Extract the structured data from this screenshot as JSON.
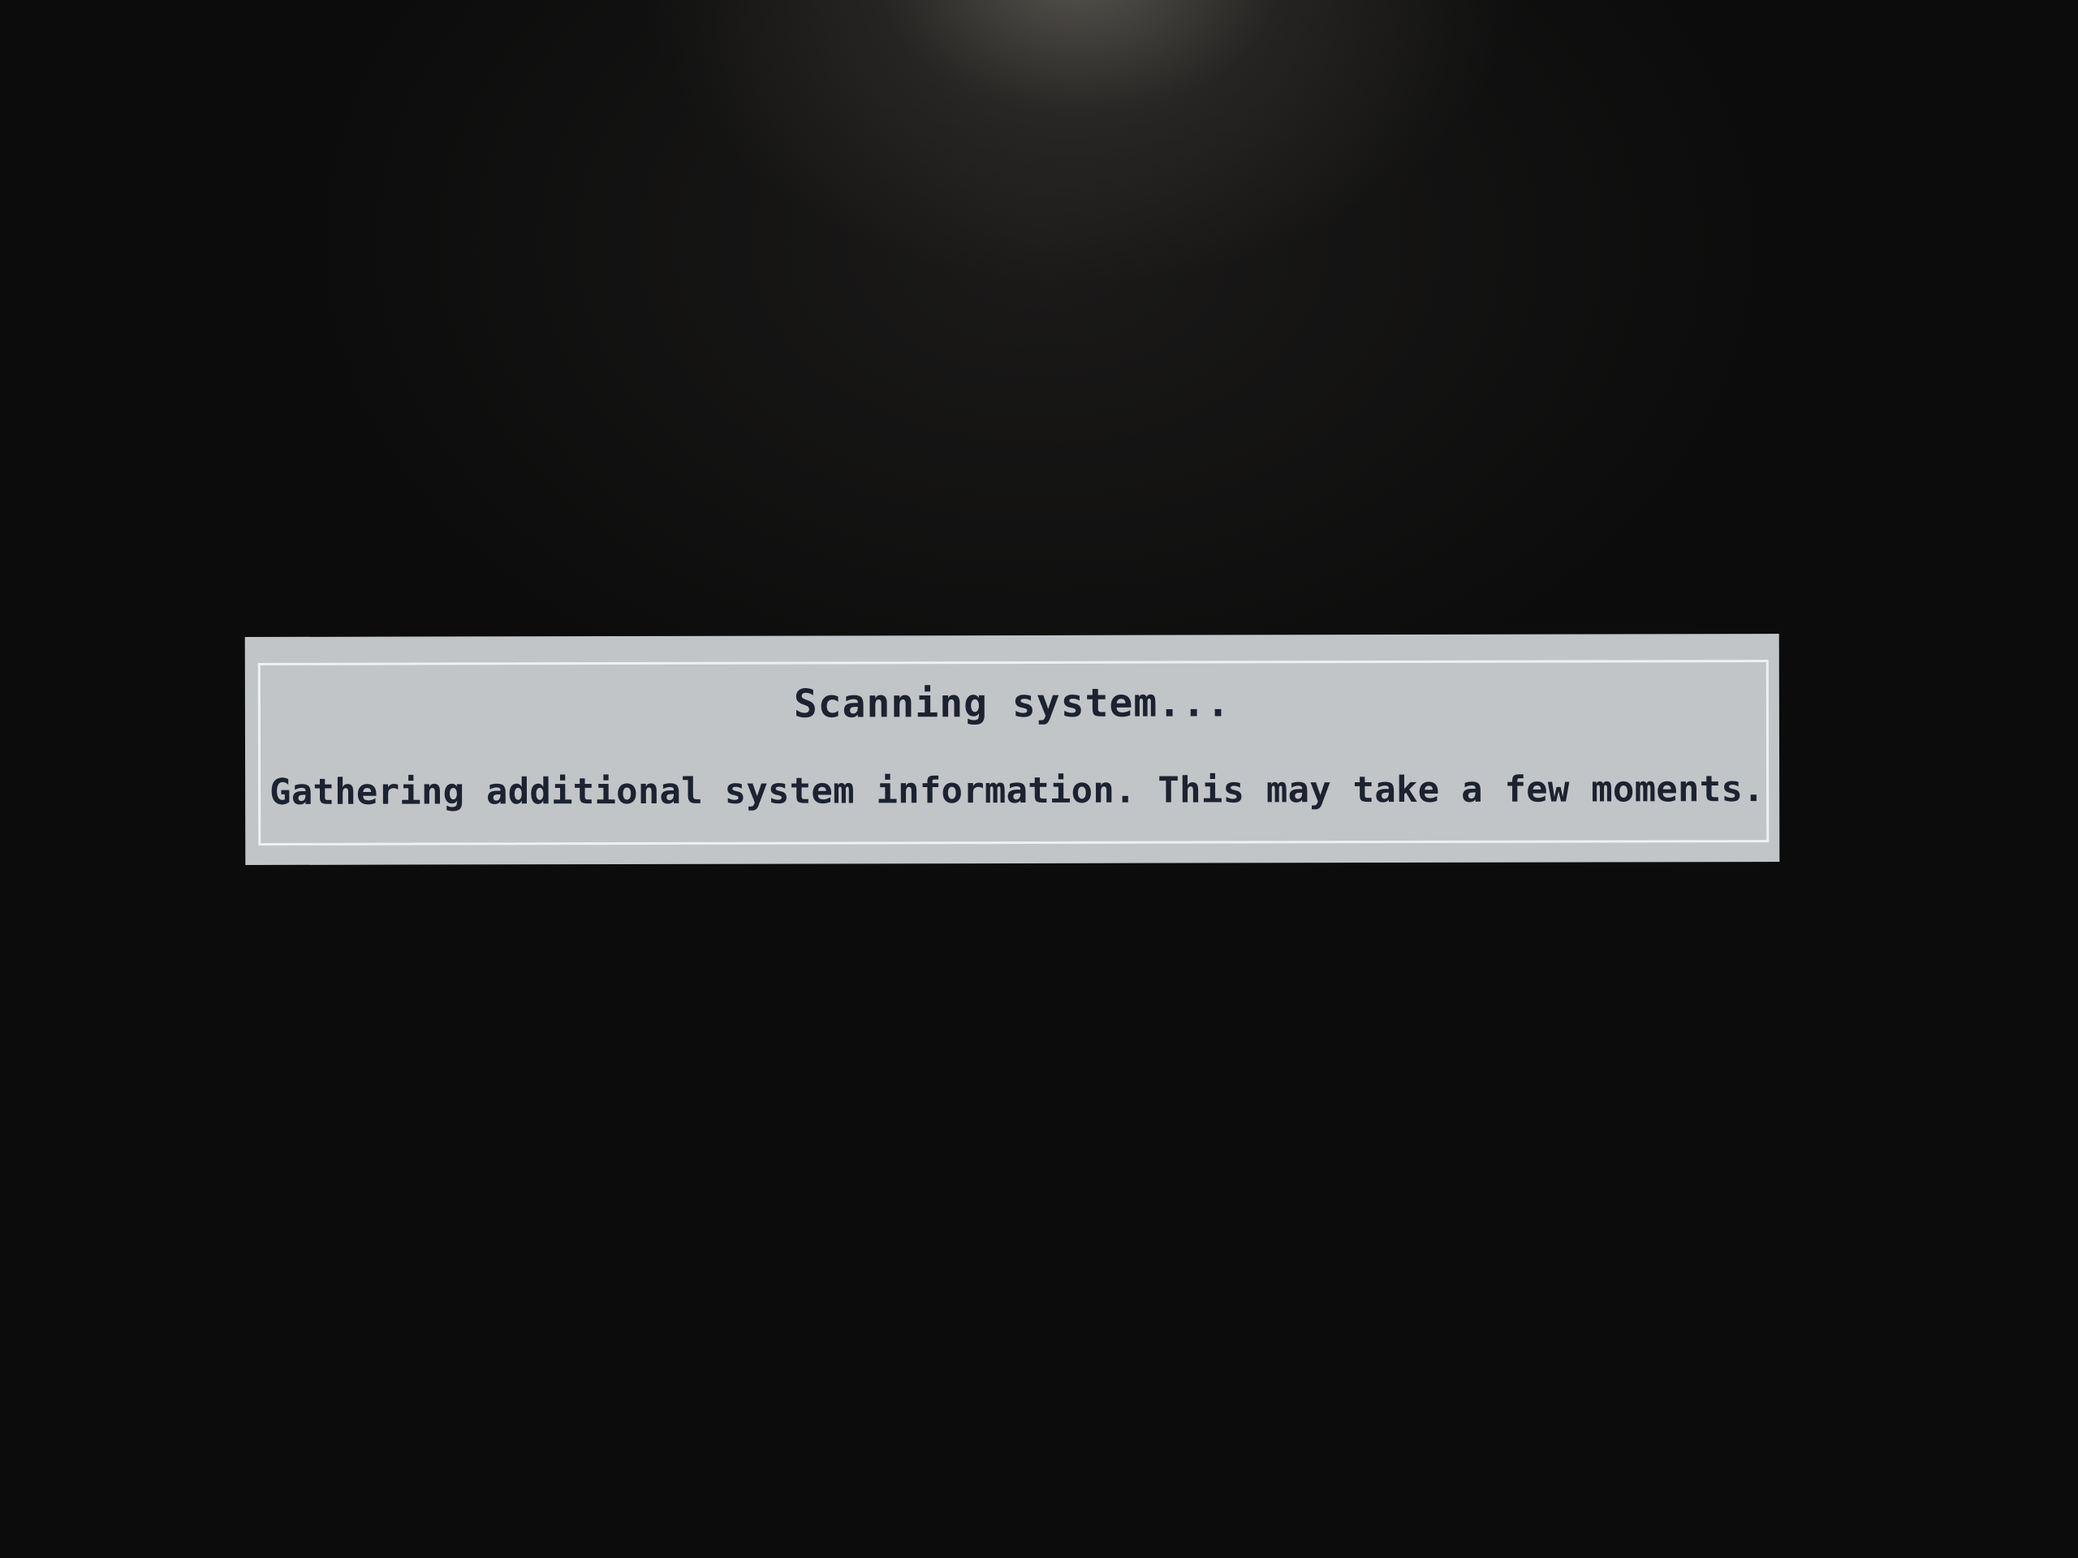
{
  "dialog": {
    "title": "Scanning system...",
    "message": "Gathering additional system information. This may take a few moments."
  },
  "colors": {
    "screen_background": "#0c0c0c",
    "dialog_background": "#c2c5c7",
    "dialog_border": "#eef0f1",
    "dialog_text": "#1c2230"
  }
}
